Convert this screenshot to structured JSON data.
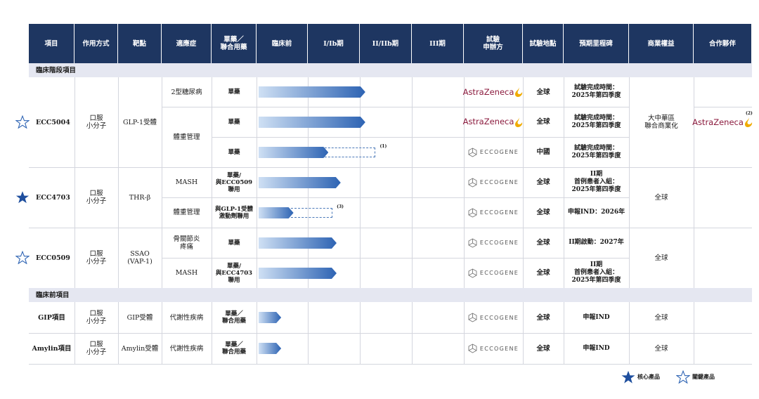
{
  "headers": [
    "項目",
    "作用方式",
    "靶點",
    "適應症",
    "單藥／\n聯合用藥",
    "臨床前",
    "I/Ib期",
    "II/IIb期",
    "III期",
    "試驗\n申辦方",
    "試驗地點",
    "預期里程碑",
    "商業權益",
    "合作夥伴"
  ],
  "sections": {
    "clinical": "臨床階段項目",
    "preclinical": "臨床前項目"
  },
  "programs": [
    {
      "name": "ECC5004",
      "moa": "口服\n小分子",
      "target": "GLP-1受體",
      "star": "key",
      "commercial": "大中華區\n聯合商業化",
      "partner": "AstraZeneca"
    },
    {
      "name": "ECC4703",
      "moa": "口服\n小分子",
      "target": "THR-β",
      "star": "core",
      "commercial": "全球",
      "partner": ""
    },
    {
      "name": "ECC0509",
      "moa": "口服\n小分子",
      "target": "SSAO\n(VAP-1)",
      "star": "key",
      "commercial": "全球",
      "partner": ""
    },
    {
      "name": "GIP項目",
      "moa": "口服\n小分子",
      "target": "GIP受體",
      "star": "",
      "commercial": "全球",
      "partner": ""
    },
    {
      "name": "Amylin項目",
      "moa": "口服\n小分子",
      "target": "Amylin受體",
      "star": "",
      "commercial": "全球",
      "partner": ""
    }
  ],
  "rows": [
    {
      "indication": "2型糖尿病",
      "regimen": "單藥",
      "progress": 0.52,
      "planned": null,
      "note": "",
      "sponsor": "AstraZeneca",
      "location": "全球",
      "milestone": "試驗完成時間：\n2025年第四季度"
    },
    {
      "indication": "體重管理",
      "regimen": "單藥",
      "progress": 0.52,
      "planned": null,
      "note": "",
      "sponsor": "AstraZeneca",
      "location": "全球",
      "milestone": "試驗完成時間：\n2025年第四季度"
    },
    {
      "indication": "",
      "regimen": "單藥",
      "progress": 0.34,
      "planned": 0.57,
      "note": "(1)",
      "sponsor": "ECCOGENE",
      "location": "中國",
      "milestone": "試驗完成時間：\n2025年第四季度"
    },
    {
      "indication": "MASH",
      "regimen": "單藥/\n與ECC0509\n聯用",
      "progress": 0.4,
      "planned": null,
      "note": "",
      "sponsor": "ECCOGENE",
      "location": "全球",
      "milestone": "II期\n首例患者入組：\n2025年第四季度"
    },
    {
      "indication": "體重管理",
      "regimen": "與GLP-1受體\n激動劑聯用",
      "progress": 0.17,
      "planned": 0.36,
      "note": "(3)",
      "sponsor": "ECCOGENE",
      "location": "全球",
      "milestone": "申報IND：2026年"
    },
    {
      "indication": "骨關節炎\n疼痛",
      "regimen": "單藥",
      "progress": 0.38,
      "planned": null,
      "note": "",
      "sponsor": "ECCOGENE",
      "location": "全球",
      "milestone": "II期啟動：2027年"
    },
    {
      "indication": "MASH",
      "regimen": "單藥/\n與ECC4703\n聯用",
      "progress": 0.38,
      "planned": null,
      "note": "",
      "sponsor": "ECCOGENE",
      "location": "全球",
      "milestone": "II期\n首例患者入組：\n2025年第四季度"
    },
    {
      "indication": "代謝性疾病",
      "regimen": "單藥／\n聯合用藥",
      "progress": 0.11,
      "planned": null,
      "note": "",
      "sponsor": "ECCOGENE",
      "location": "全球",
      "milestone": "申報IND"
    },
    {
      "indication": "代謝性疾病",
      "regimen": "單藥／\n聯合用藥",
      "progress": 0.11,
      "planned": null,
      "note": "",
      "sponsor": "ECCOGENE",
      "location": "全球",
      "milestone": "申報IND"
    }
  ],
  "partner_note": "(2)",
  "legend": {
    "core": "核心產品",
    "key": "關鍵產品"
  },
  "colors": {
    "header": "#1e3661",
    "section": "#e5e7f1",
    "bar_start": "#cfe0f4",
    "bar_end": "#2d63b3",
    "star": "#1f4f9e",
    "az_text": "#8b1a3d",
    "az_mark": "#f0ab00"
  }
}
